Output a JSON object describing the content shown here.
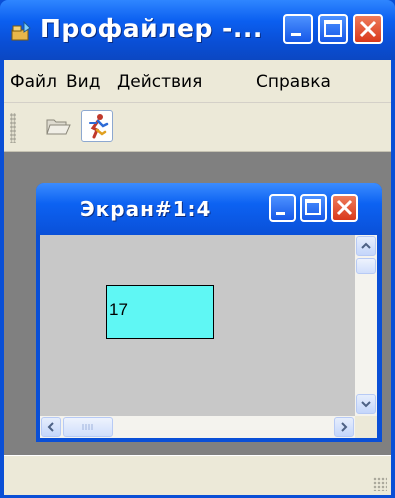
{
  "app": {
    "title": "Профайлер -..."
  },
  "menu": {
    "items": [
      "Файл",
      "Вид",
      "Действия",
      "Справка"
    ]
  },
  "toolbar": {
    "buttons": [
      "open-icon",
      "runner-icon"
    ]
  },
  "child_window": {
    "title": "Экран#1:4",
    "shape": {
      "label": "17",
      "fill": "#5ff7f4"
    }
  },
  "colors": {
    "title_blue": "#0a4fd6",
    "close_red": "#d9391c",
    "chrome": "#ece9d8",
    "mdi_bg": "#808080",
    "client_bg": "#c8c8c8"
  }
}
